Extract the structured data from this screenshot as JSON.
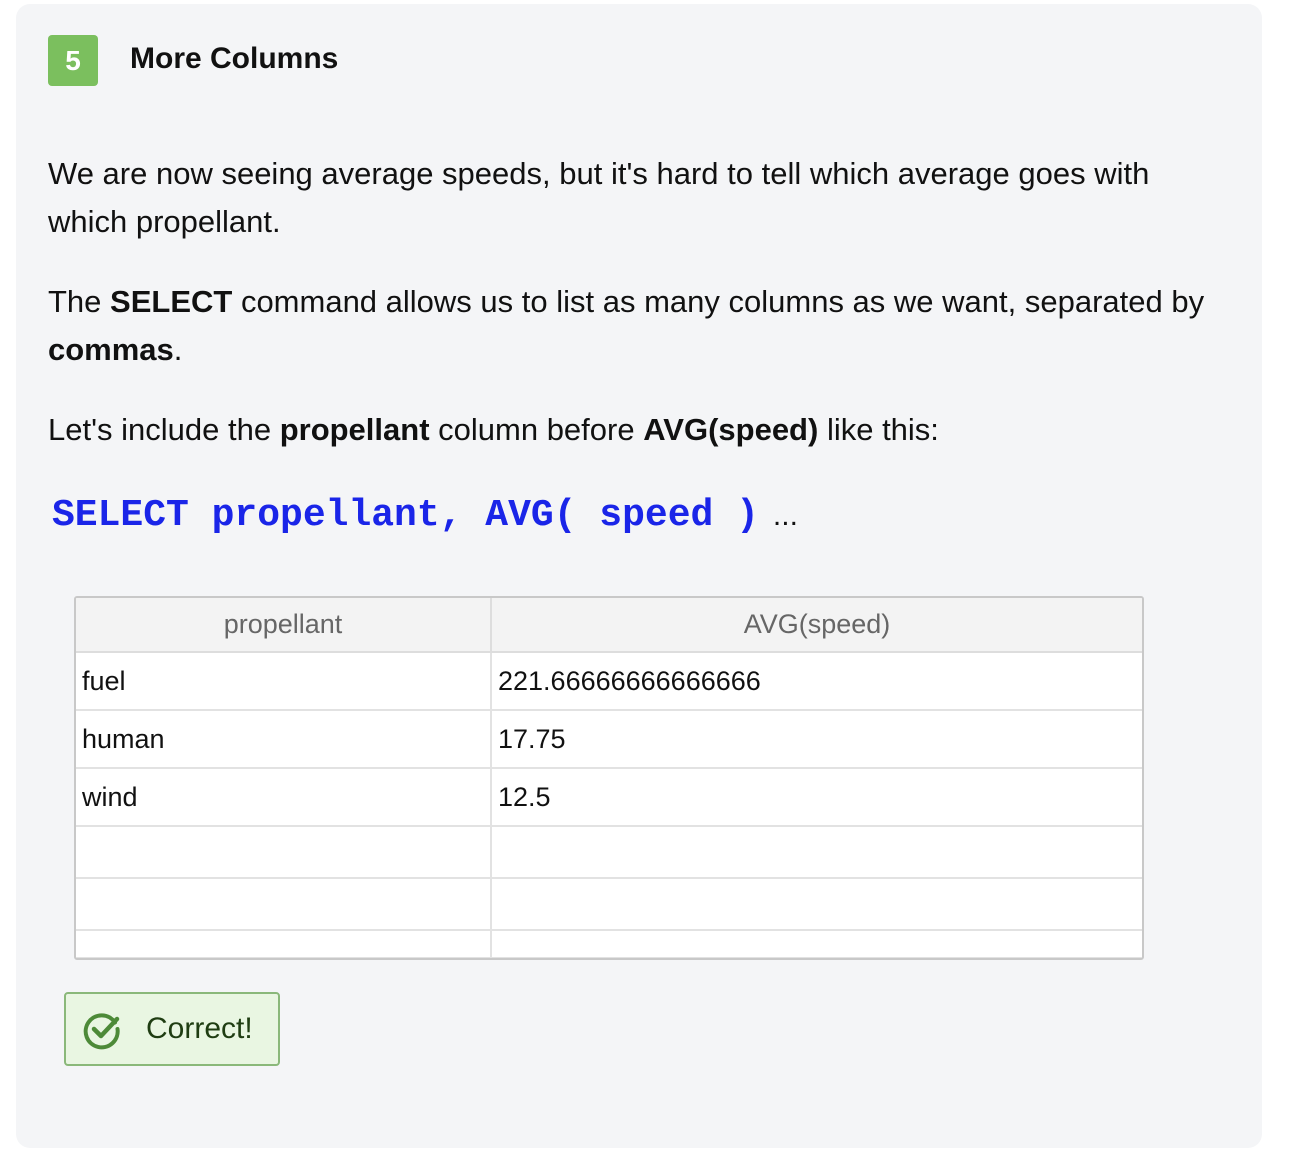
{
  "step": {
    "number": "5",
    "title": "More Columns"
  },
  "content": {
    "p1": "We are now seeing average speeds, but it's hard to tell which average goes with which propellant.",
    "p2_a": "The ",
    "p2_b": "SELECT",
    "p2_c": " command allows us to list as many columns as we want, separated by ",
    "p2_d": "commas",
    "p2_e": ".",
    "p3_a": "Let's include the ",
    "p3_b": "propellant",
    "p3_c": " column before ",
    "p3_d": "AVG(speed)",
    "p3_e": " like this:"
  },
  "code": {
    "text": "SELECT propellant, AVG( speed )",
    "ellipsis": "..."
  },
  "results": {
    "headers": [
      "propellant",
      "AVG(speed)"
    ],
    "rows": [
      [
        "fuel",
        "221.66666666666666"
      ],
      [
        "human",
        "17.75"
      ],
      [
        "wind",
        "12.5"
      ]
    ]
  },
  "status": {
    "label": "Correct!",
    "icon": "check-circle-icon",
    "accent": "#7bbf5e"
  }
}
